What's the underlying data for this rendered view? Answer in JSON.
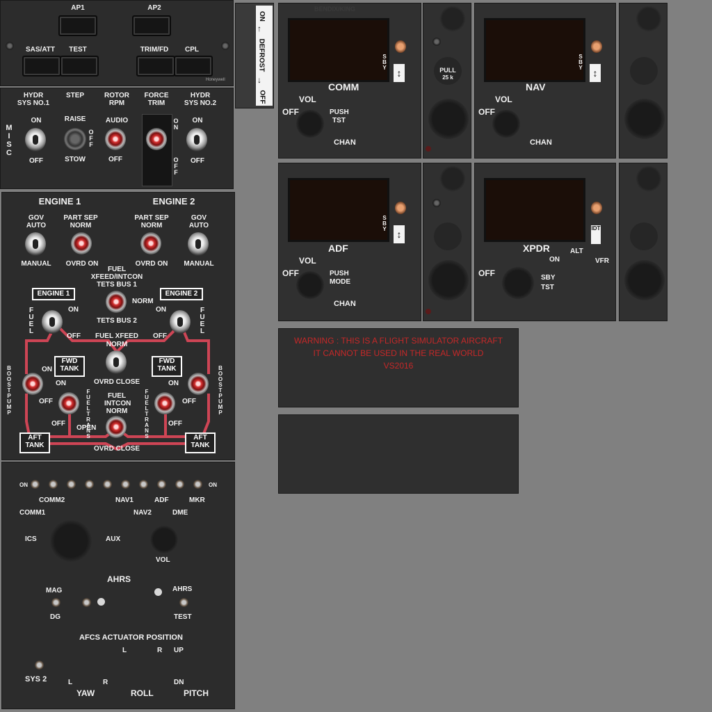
{
  "autopilot": {
    "ap1": "AP1",
    "ap2": "AP2",
    "sas_att": "SAS/ATT",
    "test": "TEST",
    "trim_fd": "TRIM/FD",
    "cpl": "CPL",
    "brand": "Honeywell"
  },
  "defrost": {
    "on": "ON",
    "label": "DEFROST",
    "off": "OFF"
  },
  "misc": {
    "title": "MISC",
    "hydr1": "HYDR SYS NO.1",
    "step": "STEP",
    "rotor_rpm": "ROTOR RPM",
    "force_trim": "FORCE TRIM",
    "hydr2": "HYDR SYS NO.2",
    "on": "ON",
    "off": "OFF",
    "raise": "RAISE",
    "stow": "STOW",
    "audio": "AUDIO"
  },
  "engine": {
    "engine1": "ENGINE 1",
    "engine2": "ENGINE 2",
    "gov_auto": "GOV AUTO",
    "part_sep_norm": "PART SEP NORM",
    "manual": "MANUAL",
    "ovrd_on": "OVRD ON",
    "fuel_xfeed_intcon": "FUEL XFEED/INTCON",
    "tets_bus1": "TETS BUS 1",
    "norm": "NORM",
    "tets_bus2": "TETS BUS 2",
    "engine1_box": "ENGINE 1",
    "engine2_box": "ENGINE 2",
    "fuel": "FUEL",
    "on": "ON",
    "off": "OFF",
    "fuel_xfeed": "FUEL XFEED",
    "ovrd_close": "OVRD CLOSE",
    "fwd_tank": "FWD TANK",
    "boost_pump": "BOOST PUMP",
    "fuel_trans": "FUEL TRANS",
    "open": "OPEN",
    "fuel_intcon_norm": "FUEL INTCON NORM",
    "aft_tank": "AFT TANK"
  },
  "audio": {
    "on": "ON",
    "comm1": "COMM1",
    "comm2": "COMM2",
    "nav1": "NAV1",
    "nav2": "NAV2",
    "adf": "ADF",
    "dme": "DME",
    "mkr": "MKR",
    "ics": "ICS",
    "aux": "AUX",
    "vol": "VOL"
  },
  "ahrs": {
    "ahrs": "AHRS",
    "mag": "MAG",
    "dg": "DG",
    "ahrs_test": "TEST",
    "ahrs2": "AHRS",
    "afcs": "AFCS ACTUATOR POSITION",
    "l": "L",
    "r": "R",
    "up": "UP",
    "dn": "DN",
    "sys2": "SYS 2",
    "yaw": "YAW",
    "roll": "ROLL",
    "pitch": "PITCH"
  },
  "radios": {
    "brand": "BENDIX/KING",
    "comm": {
      "name": "COMM",
      "vol": "VOL",
      "off": "OFF",
      "push": "PUSH",
      "tst": "TST",
      "chan": "CHAN",
      "sby": "SBY"
    },
    "nav": {
      "name": "NAV",
      "vol": "VOL",
      "off": "OFF",
      "chan": "CHAN",
      "sby": "SBY"
    },
    "adf": {
      "name": "ADF",
      "vol": "VOL",
      "off": "OFF",
      "push": "PUSH",
      "mode": "MODE",
      "chan": "CHAN",
      "sby": "SBY"
    },
    "xpdr": {
      "name": "XPDR",
      "on": "ON",
      "alt": "ALT",
      "vfr": "VFR",
      "off": "OFF",
      "sby": "SBY",
      "tst": "TST",
      "idt": "IDT"
    },
    "pull": "PULL",
    "pull_freq": "25 k"
  },
  "warning": {
    "line1": "WARNING : THIS IS A FLIGHT SIMULATOR AIRCRAFT",
    "line2": "IT CANNOT BE USED IN THE REAL WORLD",
    "line3": "VS2016"
  }
}
